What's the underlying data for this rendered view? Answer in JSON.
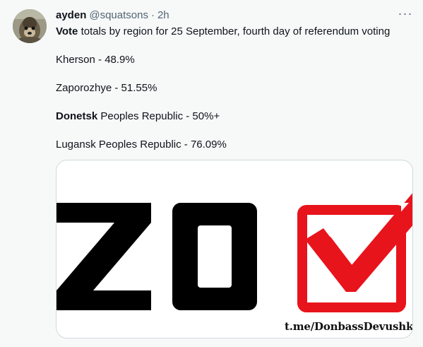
{
  "tweet": {
    "author": {
      "display_name": "ayden",
      "handle": "@squatsons",
      "separator": "·",
      "time": "2h"
    },
    "more_label": "···",
    "text": {
      "line1_bold": "Vote",
      "line1_rest": " totals by region for 25 September, fourth day of referendum voting",
      "line2": "Kherson - 48.9%",
      "line3": "Zaporozhye - 51.55%",
      "line4_bold": "Donetsk",
      "line4_rest": " Peoples Republic - 50%+",
      "line5": "Lugansk Peoples Republic -  76.09%"
    },
    "media": {
      "image_text": "ZO",
      "watermark": "t.me/DonbassDevushka",
      "colors": {
        "letters": "#000000",
        "check": "#e8141c"
      }
    }
  },
  "colors": {
    "background": "#f7f9f9",
    "text": "#0f1419",
    "secondary_text": "#536471",
    "border": "#cfd9de"
  },
  "icons": {
    "more": "more-horizontal-icon",
    "avatar": "avatar-image"
  }
}
